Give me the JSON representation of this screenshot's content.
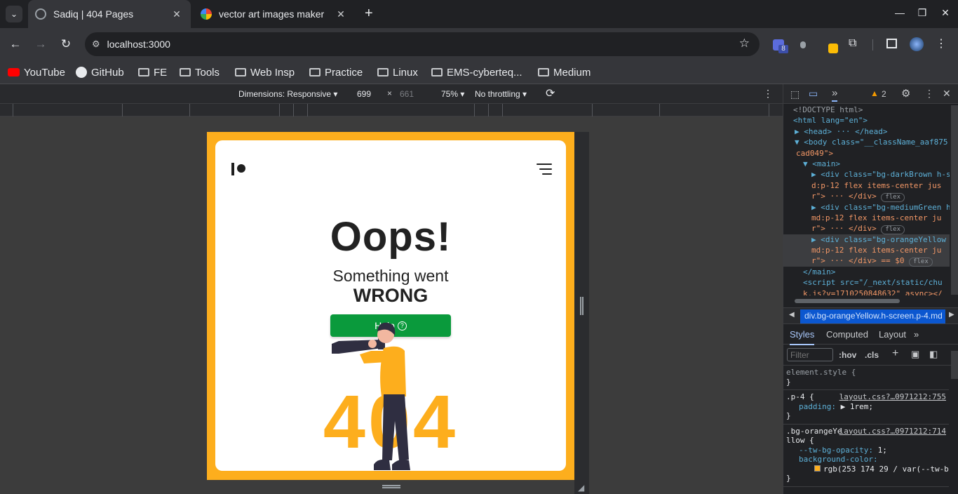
{
  "tabs": [
    {
      "title": "Sadiq | 404 Pages",
      "active": true
    },
    {
      "title": "vector art images maker",
      "active": false
    }
  ],
  "toolbar": {
    "url": "localhost:3000",
    "extension_badge": "8"
  },
  "bookmarks": [
    {
      "label": "YouTube",
      "icon": "youtube-icon"
    },
    {
      "label": "GitHub",
      "icon": "github-icon"
    },
    {
      "label": "FE",
      "icon": "folder-icon"
    },
    {
      "label": "Tools",
      "icon": "folder-icon"
    },
    {
      "label": "Web Insp",
      "icon": "folder-icon"
    },
    {
      "label": "Practice",
      "icon": "folder-icon"
    },
    {
      "label": "Linux",
      "icon": "folder-icon"
    },
    {
      "label": "EMS-cyberteq...",
      "icon": "folder-icon"
    },
    {
      "label": "Medium",
      "icon": "folder-icon"
    }
  ],
  "device_toolbar": {
    "dimensions": "Dimensions: Responsive",
    "width": "699",
    "times": "×",
    "height": "661",
    "zoom": "75%",
    "throttle": "No throttling"
  },
  "page": {
    "title": "Oops!",
    "subtitle_line1": "Something went",
    "subtitle_line2": "WRONG",
    "help_button": "Help",
    "help_icon": "?",
    "error_code": "404",
    "colors": {
      "background": "#fdae1d",
      "button": "#0a9a3c",
      "text": "#222222"
    }
  },
  "devtools": {
    "warning_count": "2",
    "dom_lines": [
      {
        "t": "<!DOCTYPE html>"
      },
      {
        "t": "<html lang=\"en\">"
      },
      {
        "t": "▶ <head> ··· </head>"
      },
      {
        "t": "▼ <body class=\"__className_aaf875"
      },
      {
        "t": "  cad049\">"
      },
      {
        "t": "▼ <main>"
      },
      {
        "t": "▶ <div class=\"bg-darkBrown h-s"
      },
      {
        "t": "  d:p-12 flex items-center jus"
      },
      {
        "t": "  r\"> ··· </div>"
      },
      {
        "t": "▶ <div class=\"bg-mediumGreen h"
      },
      {
        "t": "  md:p-12 flex items-center ju"
      },
      {
        "t": "  r\"> ··· </div>"
      },
      {
        "t": "▶ <div class=\"bg-orangeYellow"
      },
      {
        "t": "  md:p-12 flex items-center ju"
      },
      {
        "t": "  r\"> ··· </div>  == $0"
      },
      {
        "t": "</main>"
      },
      {
        "t": "<script src=\"/_next/static/chu"
      },
      {
        "t": "k.js?v=1710250848632\" async></"
      }
    ],
    "flex_badge": "flex",
    "breadcrumb": "div.bg-orangeYellow.h-screen.p-4.md",
    "style_tabs": [
      "Styles",
      "Computed",
      "Layout"
    ],
    "filter_placeholder": "Filter",
    "hov": ":hov",
    "cls": ".cls",
    "rules": [
      {
        "selector": "element.style {",
        "source": "",
        "props": [],
        "close": "}"
      },
      {
        "selector": ".p-4 {",
        "source": "layout.css?…0971212:755",
        "props": [
          {
            "name": "padding",
            "value": "▶ 1rem;"
          }
        ],
        "close": "}"
      },
      {
        "selector": ".bg-orangeYellow {",
        "source": "layout.css?…0971212:714",
        "props": [
          {
            "name": "--tw-bg-opacity",
            "value": "1;"
          },
          {
            "name": "background-color",
            "value": "rgb(253 174 29 / var(--tw-b"
          }
        ],
        "close": "}"
      }
    ]
  }
}
